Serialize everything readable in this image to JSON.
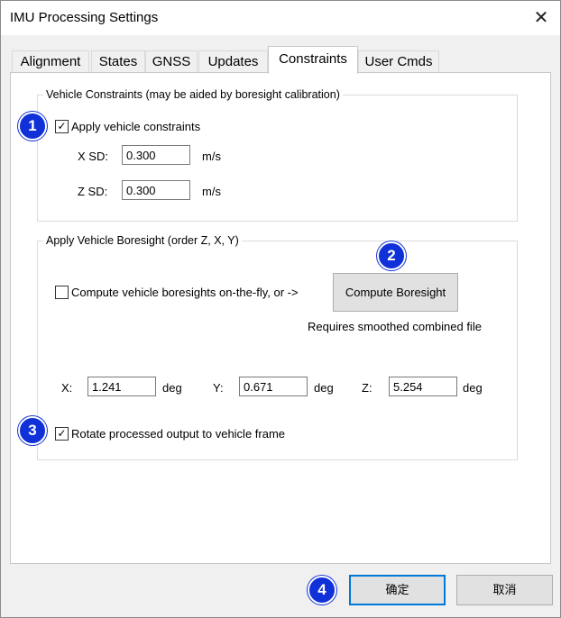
{
  "window": {
    "title": "IMU Processing Settings",
    "close_glyph": "✕"
  },
  "tabs": [
    {
      "label": "Alignment"
    },
    {
      "label": "States"
    },
    {
      "label": "GNSS"
    },
    {
      "label": "Updates"
    },
    {
      "label": "Constraints",
      "active": true
    },
    {
      "label": "User Cmds"
    }
  ],
  "constraints": {
    "legend": "Vehicle Constraints (may be aided by boresight calibration)",
    "apply_label": "Apply vehicle constraints",
    "apply_checked": true,
    "check_glyph": "✓",
    "xsd_label": "X SD:",
    "xsd_value": "0.300",
    "xsd_unit": "m/s",
    "zsd_label": "Z SD:",
    "zsd_value": "0.300",
    "zsd_unit": "m/s"
  },
  "boresight": {
    "legend": "Apply Vehicle Boresight (order Z, X, Y)",
    "compute_label": "Compute vehicle boresights on-the-fly, or ->",
    "compute_checked": false,
    "compute_button": "Compute Boresight",
    "requires_note": "Requires smoothed combined file",
    "x_label": "X:",
    "x_value": "1.241",
    "x_unit": "deg",
    "y_label": "Y:",
    "y_value": "0.671",
    "y_unit": "deg",
    "z_label": "Z:",
    "z_value": "5.254",
    "z_unit": "deg",
    "rotate_label": "Rotate processed output to vehicle frame",
    "rotate_checked": true
  },
  "footer": {
    "ok_label": "确定",
    "cancel_label": "取消"
  },
  "badges": [
    "1",
    "2",
    "3",
    "4"
  ],
  "colors": {
    "badge": "#1030d8",
    "default_button_border": "#0078d7"
  }
}
